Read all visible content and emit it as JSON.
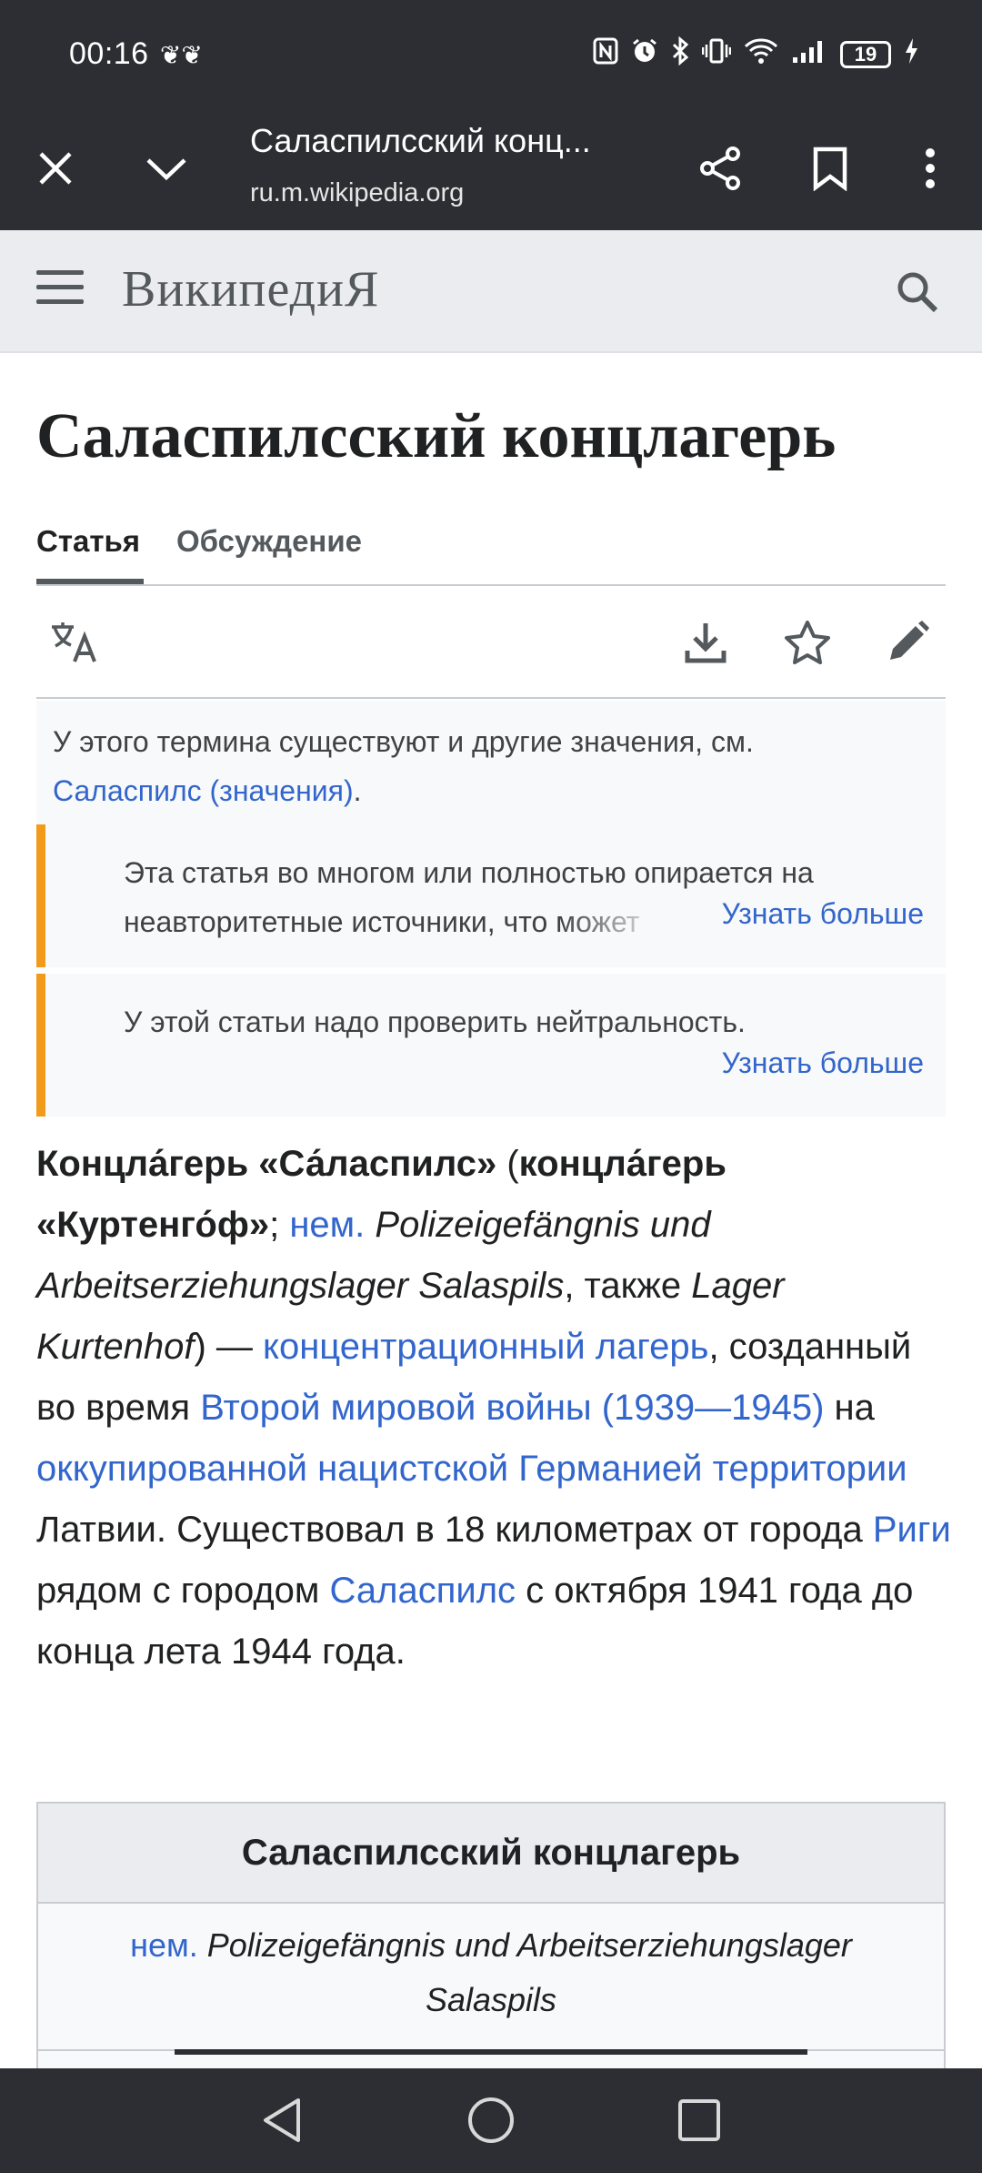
{
  "status_bar": {
    "time": "00:16",
    "time_icons": "❦❦",
    "battery": "19"
  },
  "browser": {
    "page_title": "Саласпилсский конц...",
    "host": "ru.m.wikipedia.org"
  },
  "wiki_header": {
    "wordmark": "ВикипедиЯ"
  },
  "article": {
    "title": "Саласпилсский концлагерь",
    "tabs": [
      {
        "label": "Статья",
        "active": true
      },
      {
        "label": "Обсуждение",
        "active": false
      }
    ],
    "hatnote": {
      "text": "У этого термина существуют и другие значения, см.",
      "link": "Саласпилс (значения)",
      "suffix": "."
    },
    "notices": [
      {
        "line1": "Эта статья во многом или полностью опирается на",
        "line2": "неавторитетные источники, что может",
        "more": "Узнать больше"
      },
      {
        "line1": "У этой статьи надо проверить нейтральность.",
        "more": "Узнать больше"
      }
    ],
    "paragraph": {
      "b1": "Концла́герь «Са́ласпилс»",
      "t1": " (",
      "b2": "концла́герь «Куртенго́ф»",
      "t2": "; ",
      "l1": "нем.",
      "t3": " ",
      "i1": "Polizeigefängnis und Arbeitserziehungslager Salaspils",
      "t4": ", также ",
      "i2": "Lager Kurtenhof",
      "t5": ") — ",
      "l2": "концентрационный лагерь",
      "t6": ", созданный во время ",
      "l3": "Второй мировой войны (1939—1945)",
      "t7": " на ",
      "l4": "оккупированной нацистской Германией территории",
      "t8": " Латвии. Существовал в 18 километрах от города ",
      "l5": "Риги",
      "t9": " рядом с городом ",
      "l6": "Саласпилс",
      "t10": " с октября 1941 года до конца лета 1944 года."
    },
    "infobox": {
      "title": "Саласпилсский концлагерь",
      "lang_link": "нем.",
      "original_name": "Polizeigefängnis und Arbeitserziehungslager Salaspils"
    }
  },
  "colors": {
    "chrome": "#2d2e33",
    "link": "#3366cc",
    "notice_border": "#f29b1b",
    "header_bg": "#eaecf0"
  },
  "icons": {
    "close": "close-icon",
    "collapse": "chevron-down-icon",
    "share": "share-icon",
    "bookmark": "bookmark-icon",
    "menu": "more-vert-icon",
    "search": "search-icon",
    "language": "translate-icon",
    "download": "download-icon",
    "watch": "star-icon",
    "edit": "pencil-icon"
  }
}
